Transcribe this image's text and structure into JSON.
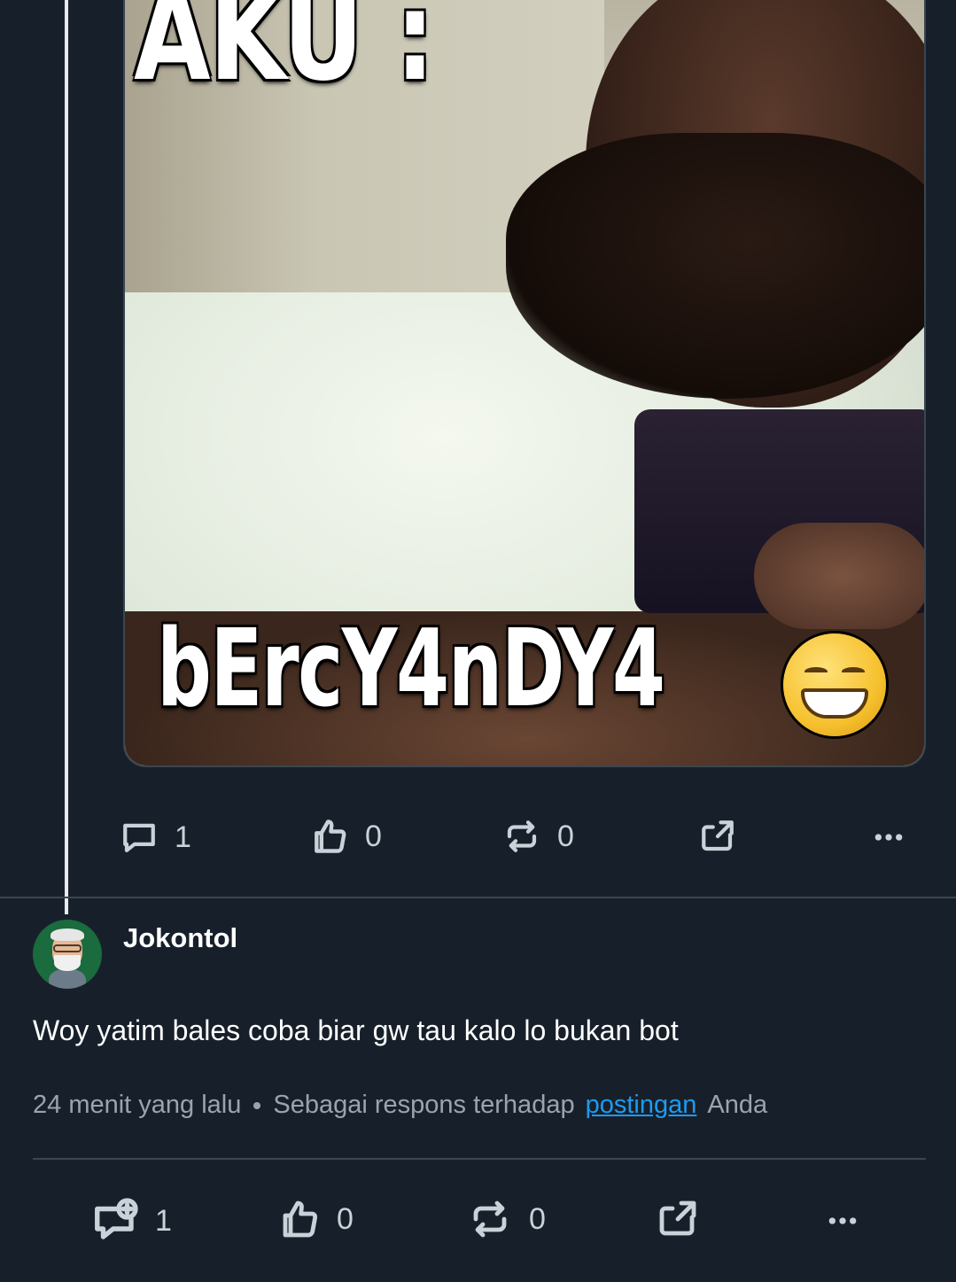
{
  "post": {
    "media": {
      "meme_top_text": "AKU :",
      "meme_bottom_text": "bErcY4nDY4"
    },
    "actions": {
      "comment_count": "1",
      "like_count": "0",
      "repost_count": "0"
    }
  },
  "reply": {
    "username": "Jokontol",
    "text": "Woy yatim bales coba biar gw tau kalo lo bukan bot",
    "time": "24 menit yang lalu",
    "context_prefix": "Sebagai respons terhadap",
    "context_link": "postingan",
    "context_suffix": "Anda",
    "actions": {
      "comment_count": "1",
      "like_count": "0",
      "repost_count": "0"
    }
  },
  "icons": {
    "comment": "comment-icon",
    "comment_add": "comment-add-icon",
    "like": "thumbs-up-icon",
    "repost": "repost-icon",
    "share": "share-icon",
    "more": "more-icon"
  },
  "colors": {
    "background": "#17202a",
    "divider": "#3a4651",
    "link": "#1d9bf0",
    "avatar_bg": "#1a6b3d",
    "muted_text": "#9aa4ae"
  }
}
